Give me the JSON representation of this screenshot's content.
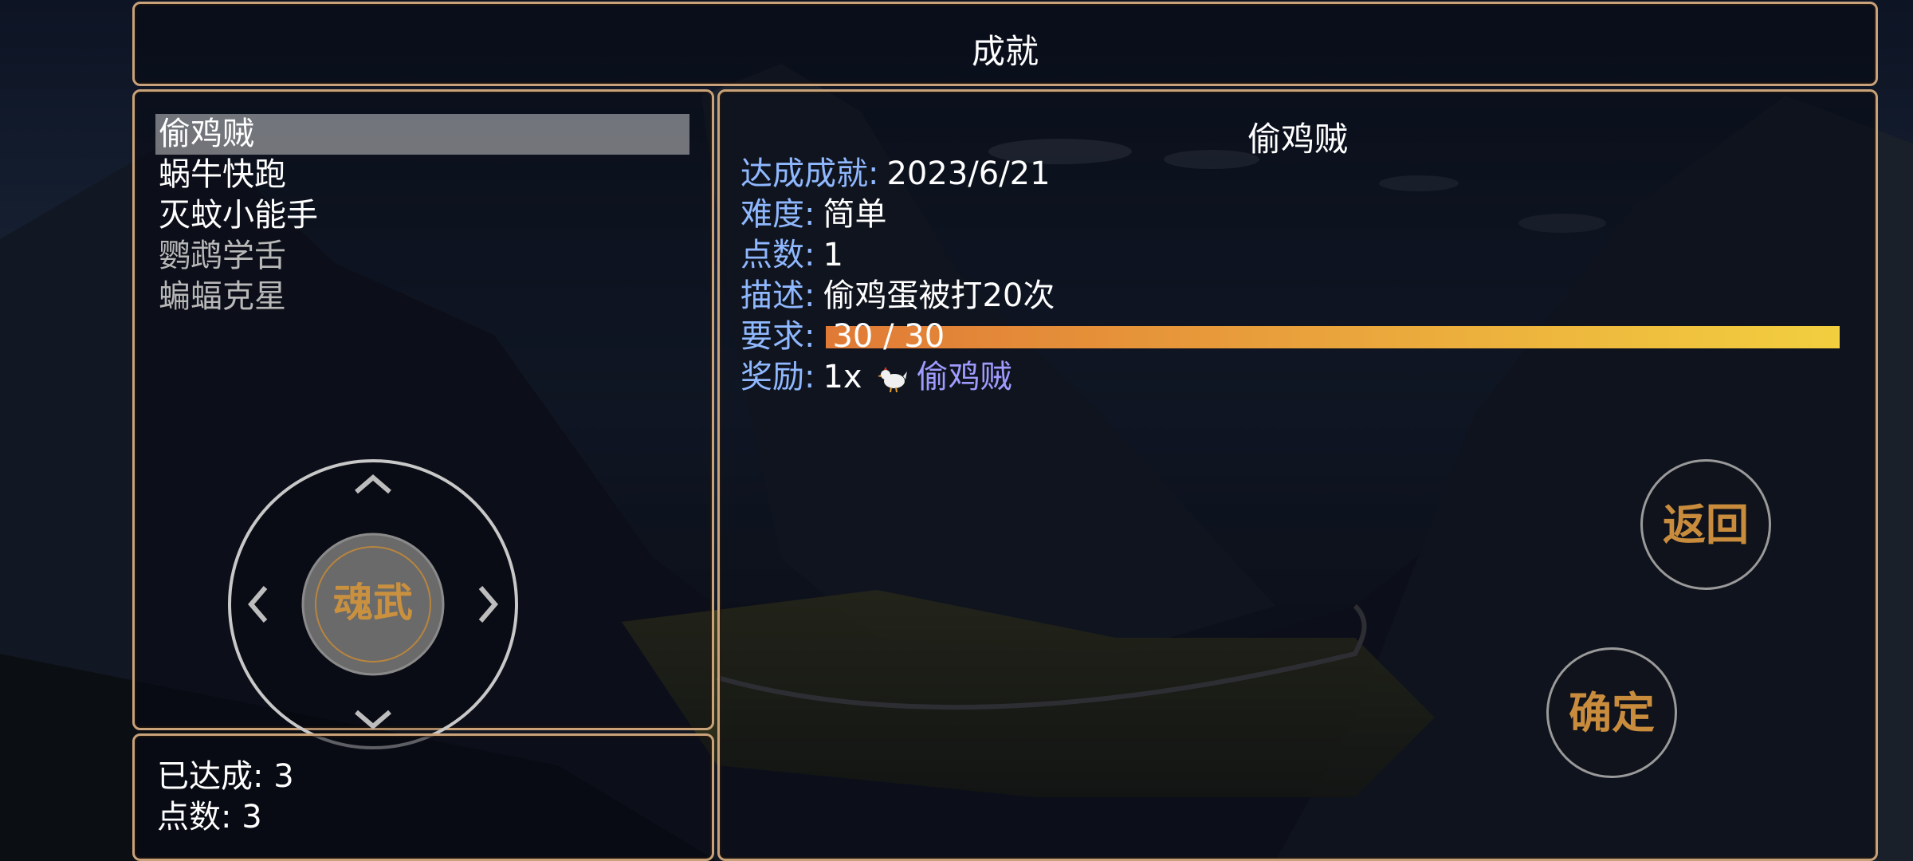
{
  "header": {
    "title": "成就"
  },
  "achievements": [
    {
      "label": "偷鸡贼",
      "selected": true,
      "completed": true
    },
    {
      "label": "蜗牛快跑",
      "selected": false,
      "completed": true
    },
    {
      "label": "灭蚊小能手",
      "selected": false,
      "completed": true
    },
    {
      "label": "鹦鹉学舌",
      "selected": false,
      "completed": false
    },
    {
      "label": "蝙蝠克星",
      "selected": false,
      "completed": false
    }
  ],
  "summary": {
    "achieved": "已达成: 3",
    "points": "点数: 3"
  },
  "detail": {
    "title": "偷鸡贼",
    "achieved_label": "达成成就:",
    "achieved_value": "2023/6/21",
    "difficulty_label": "难度:",
    "difficulty_value": "简单",
    "points_label": "点数:",
    "points_value": "1",
    "description_label": "描述:",
    "description_value": "偷鸡蛋被打20次",
    "requirement_label": "要求:",
    "requirement_text": "30 / 30",
    "requirement_progress": 1.0,
    "reward_label": "奖励:",
    "reward_count": "1x",
    "reward_item": "偷鸡贼",
    "reward_icon": "chicken-icon"
  },
  "buttons": {
    "back": "返回",
    "confirm": "确定"
  },
  "joystick": {
    "center_glyph": "魂武"
  },
  "colors": {
    "frame": "#c9a27a",
    "label": "#8fb8ff",
    "link": "#9f9bff",
    "progress_start": "#e07a36",
    "progress_end": "#f2cf3f",
    "button_text": "#c98c3d"
  }
}
